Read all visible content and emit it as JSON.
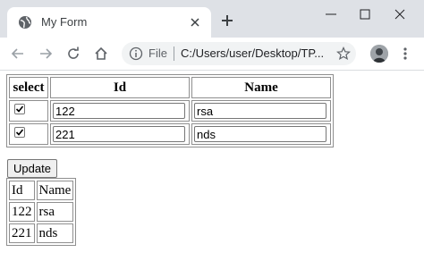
{
  "browser": {
    "tab_title": "My Form",
    "url_scheme": "File",
    "url": "C:/Users/user/Desktop/TP..."
  },
  "form": {
    "headers": {
      "select": "select",
      "id": "Id",
      "name": "Name"
    },
    "rows": [
      {
        "checked": true,
        "id": "122",
        "name": "rsa"
      },
      {
        "checked": true,
        "id": "221",
        "name": "nds"
      }
    ],
    "update_label": "Update"
  },
  "result": {
    "headers": {
      "id": "Id",
      "name": "Name"
    },
    "rows": [
      {
        "id": "122",
        "name": "rsa"
      },
      {
        "id": "221",
        "name": "nds"
      }
    ]
  },
  "icons": {
    "favicon": "globe-icon",
    "close": "close-icon",
    "new_tab": "plus-icon",
    "back": "back-arrow-icon",
    "forward": "forward-arrow-icon",
    "reload": "reload-icon",
    "home": "home-icon",
    "info": "info-icon",
    "bookmark": "star-icon",
    "profile": "avatar",
    "menu": "kebab-menu-icon"
  },
  "colors": {
    "tabstrip": "#dee1e6",
    "omnibox": "#f1f3f4",
    "border": "#8f8f8f"
  }
}
